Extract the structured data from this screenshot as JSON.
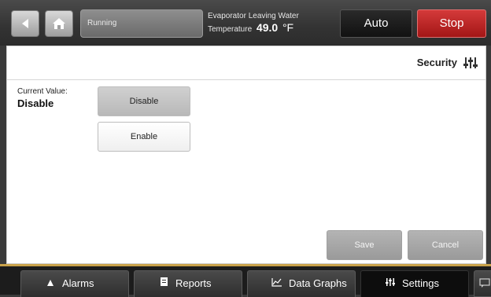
{
  "header": {
    "status": "Running",
    "measurement_label_line1": "Evaporator Leaving Water",
    "measurement_label_line2": "Temperature",
    "measurement_value": "49.0",
    "measurement_unit": "°F",
    "auto_label": "Auto",
    "stop_label": "Stop"
  },
  "panel": {
    "section_title": "Security",
    "current_value_label": "Current Value:",
    "current_value": "Disable",
    "options": [
      {
        "label": "Disable",
        "selected": true
      },
      {
        "label": "Enable",
        "selected": false
      }
    ],
    "save_label": "Save",
    "cancel_label": "Cancel"
  },
  "tabs": [
    {
      "label": "Alarms",
      "icon": "alarm-triangle-icon",
      "active": false
    },
    {
      "label": "Reports",
      "icon": "report-icon",
      "active": false
    },
    {
      "label": "Data Graphs",
      "icon": "graph-icon",
      "active": false
    },
    {
      "label": "Settings",
      "icon": "settings-sliders-icon",
      "active": true
    }
  ],
  "colors": {
    "stop": "#c02626",
    "tab_accent": "#c9a24a",
    "active_tab": "#0d0d0d"
  }
}
